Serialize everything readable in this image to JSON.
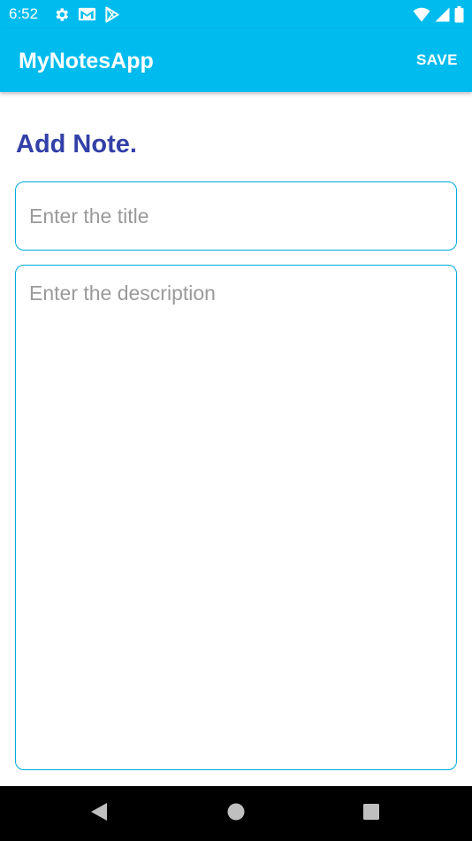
{
  "status_bar": {
    "time": "6:52",
    "left_icons": [
      "gear-icon",
      "gmail-icon",
      "play-store-icon"
    ],
    "right_icons": [
      "wifi-icon",
      "cell-signal-icon",
      "battery-icon"
    ]
  },
  "app_bar": {
    "title": "MyNotesApp",
    "save_label": "SAVE"
  },
  "form": {
    "heading": "Add Note.",
    "title_placeholder": "Enter the title",
    "title_value": "",
    "description_placeholder": "Enter the description",
    "description_value": ""
  },
  "nav_bar": {
    "icons": [
      "back-icon",
      "home-icon",
      "recents-icon"
    ]
  },
  "colors": {
    "app_bar": "#00bcee",
    "heading": "#3240a7",
    "field_border": "#00a8dc",
    "placeholder": "#9a9a9a",
    "nav_bar": "#000000"
  }
}
